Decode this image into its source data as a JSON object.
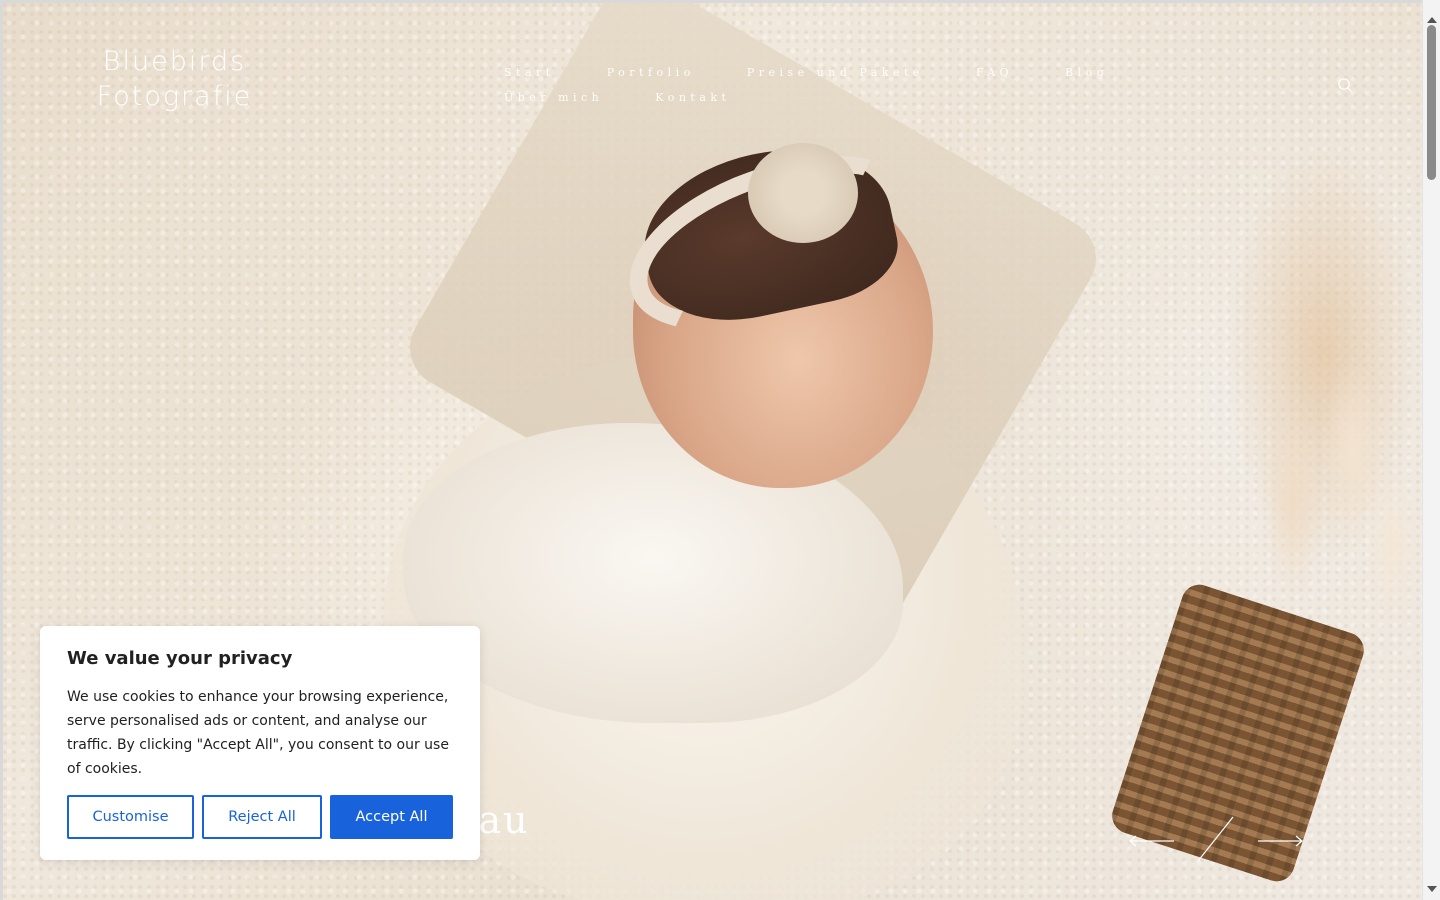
{
  "brand": {
    "logo_line1": "Bluebirds",
    "logo_line2": "Fotografie"
  },
  "nav": {
    "row1": [
      "Start",
      "Portfolio",
      "Preise und Pakete",
      "FAQ",
      "Blog"
    ],
    "row2": [
      "Über mich",
      "Kontakt"
    ]
  },
  "header_icons": {
    "search": "search-icon"
  },
  "hero": {
    "caption_visible": "nau",
    "slider": {
      "prev": "arrow-left-icon",
      "next": "arrow-right-icon"
    }
  },
  "cookie_banner": {
    "title": "We value your privacy",
    "text": "We use cookies to enhance your browsing experience, serve personalised ads or content, and analyse our traffic. By clicking \"Accept All\", you consent to our use of cookies.",
    "buttons": {
      "customise": "Customise",
      "reject": "Reject All",
      "accept": "Accept All"
    }
  },
  "colors": {
    "accent": "#1863dc",
    "text": "#212121",
    "white": "#ffffff"
  }
}
